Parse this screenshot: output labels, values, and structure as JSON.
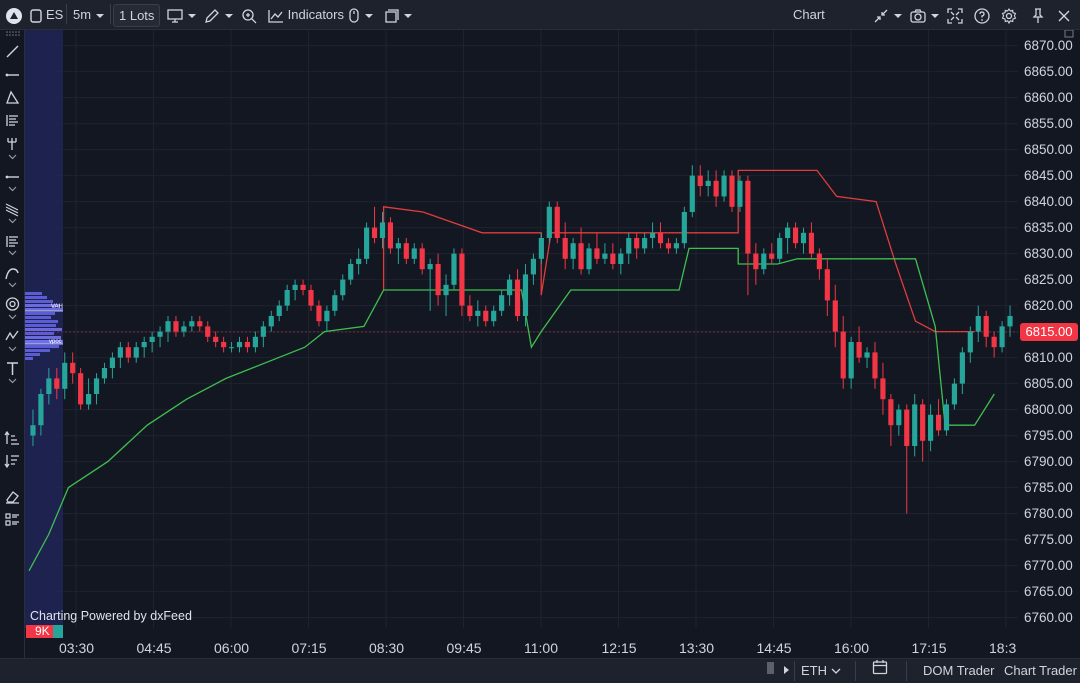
{
  "toolbar": {
    "symbol": "ES",
    "interval": "5m",
    "lots": "1 Lots",
    "indicators_label": "Indicators",
    "title": "Chart"
  },
  "chart": {
    "last_price": "6815.00",
    "powered_by": "Charting Powered by dxFeed",
    "volume_badge": "9K",
    "vah_label": "VAH",
    "vpoc_label": "vpoc",
    "price_ticks": [
      "6870.00",
      "6865.00",
      "6860.00",
      "6855.00",
      "6850.00",
      "6845.00",
      "6840.00",
      "6835.00",
      "6830.00",
      "6825.00",
      "6820.00",
      "6815.00",
      "6810.00",
      "6805.00",
      "6800.00",
      "6795.00",
      "6790.00",
      "6785.00",
      "6780.00",
      "6775.00",
      "6770.00",
      "6765.00",
      "6760.00"
    ],
    "time_ticks": [
      "03:30",
      "04:45",
      "06:00",
      "07:15",
      "08:30",
      "09:45",
      "11:00",
      "12:15",
      "13:30",
      "14:45",
      "16:00",
      "17:15",
      "18:3"
    ],
    "colors": {
      "up": "#26a69a",
      "down": "#f23645",
      "upper_band": "#e03c3c",
      "lower_band": "#3fbf4f",
      "background": "#131722"
    }
  },
  "chart_data": {
    "type": "candlestick",
    "ylim": [
      6758,
      6873
    ],
    "candles": [
      [
        6795,
        6800,
        6793,
        6797
      ],
      [
        6797,
        6804,
        6795,
        6803
      ],
      [
        6803,
        6808,
        6801,
        6806
      ],
      [
        6806,
        6808,
        6802,
        6804
      ],
      [
        6804,
        6811,
        6802,
        6809
      ],
      [
        6809,
        6811,
        6805,
        6807
      ],
      [
        6807,
        6808,
        6800,
        6801
      ],
      [
        6801,
        6806,
        6800,
        6803
      ],
      [
        6803,
        6807,
        6801,
        6806
      ],
      [
        6806,
        6809,
        6805,
        6808
      ],
      [
        6808,
        6811,
        6806,
        6810
      ],
      [
        6810,
        6813,
        6808,
        6812
      ],
      [
        6812,
        6813,
        6809,
        6810
      ],
      [
        6810,
        6813,
        6809,
        6812
      ],
      [
        6812,
        6814,
        6810,
        6813
      ],
      [
        6813,
        6815,
        6811,
        6814
      ],
      [
        6814,
        6816,
        6812,
        6815
      ],
      [
        6815,
        6818,
        6813,
        6817
      ],
      [
        6817,
        6818,
        6814,
        6815
      ],
      [
        6815,
        6817,
        6814,
        6816
      ],
      [
        6816,
        6818,
        6815,
        6817
      ],
      [
        6817,
        6818,
        6815,
        6816
      ],
      [
        6816,
        6817,
        6813,
        6814
      ],
      [
        6814,
        6815,
        6812,
        6813
      ],
      [
        6813,
        6814,
        6811,
        6812
      ],
      [
        6812,
        6813,
        6811,
        6812
      ],
      [
        6812,
        6814,
        6811,
        6813
      ],
      [
        6813,
        6814,
        6811,
        6812
      ],
      [
        6812,
        6815,
        6811,
        6814
      ],
      [
        6814,
        6817,
        6812,
        6816
      ],
      [
        6816,
        6819,
        6815,
        6818
      ],
      [
        6818,
        6821,
        6817,
        6820
      ],
      [
        6820,
        6824,
        6819,
        6823
      ],
      [
        6823,
        6825,
        6821,
        6824
      ],
      [
        6824,
        6825,
        6822,
        6823
      ],
      [
        6823,
        6824,
        6819,
        6820
      ],
      [
        6820,
        6821,
        6816,
        6817
      ],
      [
        6817,
        6820,
        6815,
        6819
      ],
      [
        6819,
        6823,
        6818,
        6822
      ],
      [
        6822,
        6826,
        6821,
        6825
      ],
      [
        6825,
        6829,
        6824,
        6828
      ],
      [
        6828,
        6831,
        6826,
        6829
      ],
      [
        6829,
        6836,
        6828,
        6835
      ],
      [
        6835,
        6839,
        6832,
        6833
      ],
      [
        6833,
        6838,
        6831,
        6836
      ],
      [
        6836,
        6837,
        6830,
        6831
      ],
      [
        6831,
        6833,
        6828,
        6832
      ],
      [
        6832,
        6833,
        6828,
        6829
      ],
      [
        6829,
        6832,
        6828,
        6831
      ],
      [
        6831,
        6832,
        6826,
        6827
      ],
      [
        6827,
        6829,
        6819,
        6828
      ],
      [
        6828,
        6830,
        6820,
        6822
      ],
      [
        6822,
        6826,
        6818,
        6824
      ],
      [
        6824,
        6831,
        6823,
        6830
      ],
      [
        6830,
        6831,
        6818,
        6820
      ],
      [
        6820,
        6822,
        6817,
        6818
      ],
      [
        6818,
        6821,
        6816,
        6819
      ],
      [
        6819,
        6820,
        6816,
        6817
      ],
      [
        6817,
        6820,
        6816,
        6819
      ],
      [
        6819,
        6823,
        6818,
        6822
      ],
      [
        6822,
        6826,
        6820,
        6825
      ],
      [
        6825,
        6827,
        6817,
        6818
      ],
      [
        6818,
        6828,
        6816,
        6826
      ],
      [
        6826,
        6830,
        6824,
        6829
      ],
      [
        6829,
        6834,
        6828,
        6833
      ],
      [
        6833,
        6840,
        6832,
        6839
      ],
      [
        6839,
        6840,
        6832,
        6833
      ],
      [
        6833,
        6836,
        6827,
        6829
      ],
      [
        6829,
        6833,
        6827,
        6832
      ],
      [
        6832,
        6835,
        6826,
        6827
      ],
      [
        6827,
        6832,
        6826,
        6831
      ],
      [
        6831,
        6834,
        6828,
        6829
      ],
      [
        6829,
        6832,
        6828,
        6830
      ],
      [
        6830,
        6832,
        6827,
        6828
      ],
      [
        6828,
        6831,
        6826,
        6830
      ],
      [
        6830,
        6834,
        6828,
        6833
      ],
      [
        6833,
        6834,
        6829,
        6831
      ],
      [
        6831,
        6834,
        6830,
        6833
      ],
      [
        6833,
        6836,
        6831,
        6834
      ],
      [
        6834,
        6836,
        6831,
        6832
      ],
      [
        6832,
        6833,
        6830,
        6831
      ],
      [
        6831,
        6833,
        6830,
        6832
      ],
      [
        6832,
        6839,
        6831,
        6838
      ],
      [
        6838,
        6847,
        6837,
        6845
      ],
      [
        6845,
        6847,
        6841,
        6843
      ],
      [
        6843,
        6846,
        6841,
        6844
      ],
      [
        6844,
        6846,
        6839,
        6841
      ],
      [
        6841,
        6846,
        6840,
        6845
      ],
      [
        6845,
        6846,
        6838,
        6839
      ],
      [
        6839,
        6845,
        6838,
        6844
      ],
      [
        6844,
        6845,
        6822,
        6830
      ],
      [
        6830,
        6832,
        6824,
        6827
      ],
      [
        6827,
        6831,
        6826,
        6830
      ],
      [
        6830,
        6832,
        6828,
        6829
      ],
      [
        6829,
        6834,
        6828,
        6833
      ],
      [
        6833,
        6836,
        6830,
        6835
      ],
      [
        6835,
        6836,
        6831,
        6832
      ],
      [
        6832,
        6835,
        6830,
        6834
      ],
      [
        6834,
        6836,
        6829,
        6830
      ],
      [
        6830,
        6831,
        6825,
        6827
      ],
      [
        6827,
        6829,
        6818,
        6821
      ],
      [
        6821,
        6824,
        6812,
        6815
      ],
      [
        6815,
        6818,
        6804,
        6806
      ],
      [
        6806,
        6814,
        6804,
        6813
      ],
      [
        6813,
        6816,
        6809,
        6810
      ],
      [
        6810,
        6812,
        6808,
        6811
      ],
      [
        6811,
        6813,
        6804,
        6806
      ],
      [
        6806,
        6809,
        6799,
        6802
      ],
      [
        6802,
        6803,
        6793,
        6797
      ],
      [
        6797,
        6801,
        6795,
        6800
      ],
      [
        6800,
        6801,
        6780,
        6793
      ],
      [
        6793,
        6803,
        6791,
        6801
      ],
      [
        6801,
        6802,
        6790,
        6794
      ],
      [
        6794,
        6801,
        6792,
        6799
      ],
      [
        6799,
        6802,
        6795,
        6796
      ],
      [
        6796,
        6802,
        6795,
        6801
      ],
      [
        6801,
        6806,
        6800,
        6805
      ],
      [
        6805,
        6812,
        6803,
        6811
      ],
      [
        6811,
        6816,
        6809,
        6815
      ],
      [
        6815,
        6820,
        6813,
        6818
      ],
      [
        6818,
        6819,
        6812,
        6814
      ],
      [
        6814,
        6815,
        6810,
        6812
      ],
      [
        6812,
        6817,
        6811,
        6816
      ],
      [
        6816,
        6820,
        6814,
        6818
      ]
    ],
    "upper_band": [
      [
        0.36,
        6823
      ],
      [
        0.36,
        6839
      ],
      [
        0.4,
        6838
      ],
      [
        0.46,
        6834
      ],
      [
        0.52,
        6834
      ],
      [
        0.52,
        6823
      ],
      [
        0.52,
        6822
      ],
      [
        0.53,
        6834
      ],
      [
        0.6,
        6834
      ],
      [
        0.62,
        6834
      ],
      [
        0.64,
        6834
      ],
      [
        0.66,
        6834
      ],
      [
        0.7,
        6834
      ],
      [
        0.72,
        6834
      ],
      [
        0.72,
        6846
      ],
      [
        0.8,
        6846
      ],
      [
        0.82,
        6841
      ],
      [
        0.86,
        6840
      ],
      [
        0.88,
        6828
      ],
      [
        0.9,
        6817
      ],
      [
        0.92,
        6815
      ],
      [
        0.96,
        6815
      ]
    ],
    "lower_band": [
      [
        0.0,
        6769
      ],
      [
        0.02,
        6776
      ],
      [
        0.04,
        6785
      ],
      [
        0.08,
        6790
      ],
      [
        0.12,
        6797
      ],
      [
        0.16,
        6802
      ],
      [
        0.2,
        6806
      ],
      [
        0.24,
        6809
      ],
      [
        0.28,
        6812
      ],
      [
        0.3,
        6815
      ],
      [
        0.34,
        6816
      ],
      [
        0.36,
        6823
      ],
      [
        0.5,
        6823
      ],
      [
        0.51,
        6812
      ],
      [
        0.52,
        6815
      ],
      [
        0.55,
        6823
      ],
      [
        0.66,
        6823
      ],
      [
        0.67,
        6831
      ],
      [
        0.72,
        6831
      ],
      [
        0.72,
        6828
      ],
      [
        0.76,
        6828
      ],
      [
        0.78,
        6829
      ],
      [
        0.8,
        6829
      ],
      [
        0.9,
        6829
      ],
      [
        0.92,
        6816
      ],
      [
        0.93,
        6797
      ],
      [
        0.96,
        6797
      ],
      [
        0.98,
        6803
      ]
    ]
  }
}
